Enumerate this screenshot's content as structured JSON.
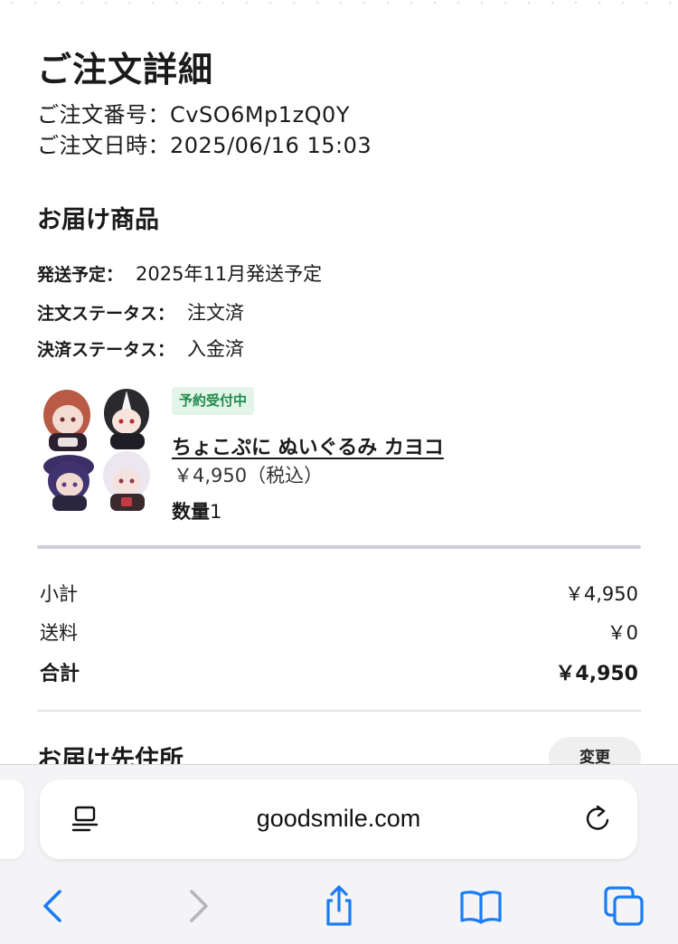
{
  "order": {
    "title": "ご注文詳細",
    "number_line": "ご注文番号：CvSO6Mp1zQ0Y",
    "date_line": "ご注文日時：2025/06/16 15:03"
  },
  "delivery": {
    "title": "お届け商品",
    "ship_label": "発送予定：",
    "ship_value": "2025年11月発送予定",
    "order_status_label": "注文ステータス：",
    "order_status_value": "注文済",
    "payment_status_label": "決済ステータス：",
    "payment_status_value": "入金済"
  },
  "product": {
    "badge": "予約受付中",
    "name": "ちょこぷに ぬいぐるみ カヨコ",
    "price": "￥4,950（税込）",
    "qty_label": "数量",
    "qty_value": "1"
  },
  "summary": {
    "subtotal_label": "小計",
    "subtotal_value": "￥4,950",
    "shipping_label": "送料",
    "shipping_value": "￥0",
    "total_label": "合計",
    "total_value": "￥4,950"
  },
  "address": {
    "title": "お届け先住所",
    "change_label": "変更"
  },
  "browser": {
    "url": "goodsmile.com",
    "accent_color": "#1a7cf5",
    "disabled_color": "#b5b5b8",
    "icons": [
      "reader-icon",
      "reload-icon",
      "back-icon",
      "forward-icon",
      "share-icon",
      "bookmarks-icon",
      "tabs-icon"
    ]
  }
}
